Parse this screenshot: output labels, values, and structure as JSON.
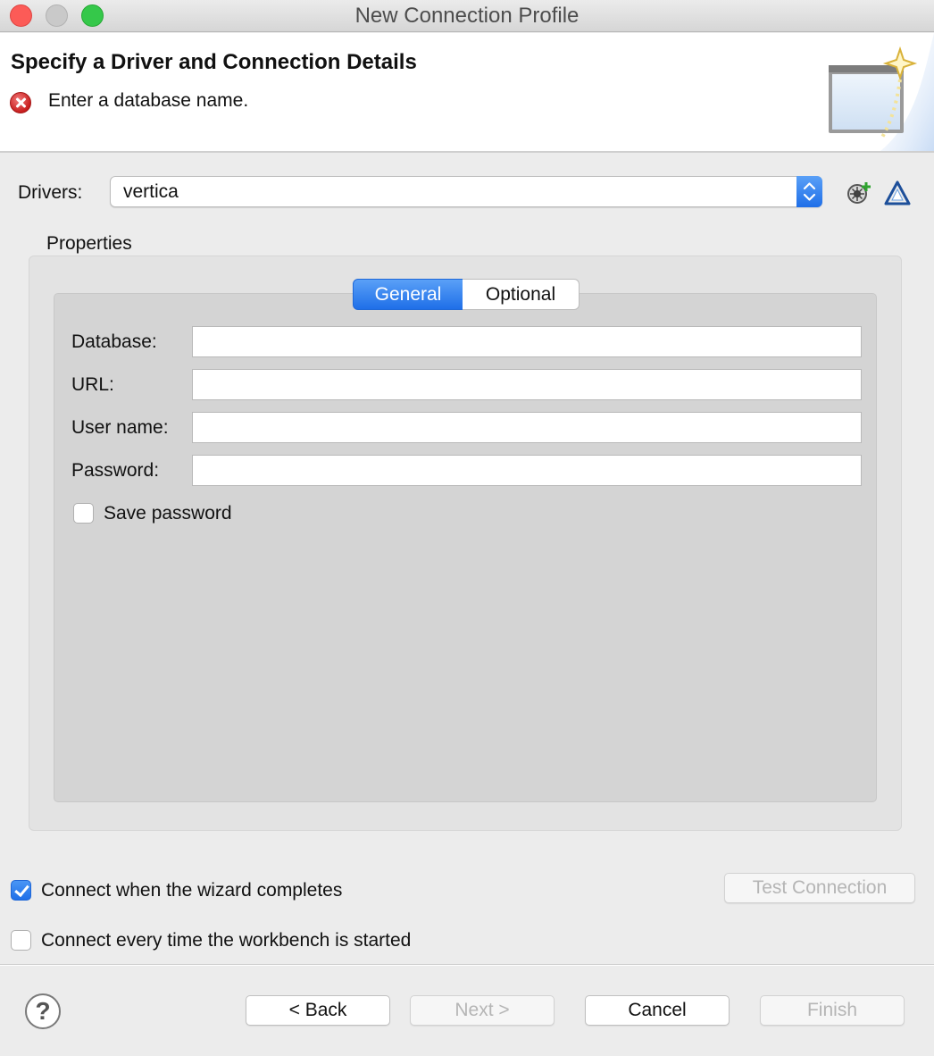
{
  "window": {
    "title": "New Connection Profile"
  },
  "header": {
    "title": "Specify a Driver and Connection Details",
    "message": "Enter a database name.",
    "message_icon": "error-icon"
  },
  "drivers": {
    "label": "Drivers:",
    "selected": "vertica",
    "new_driver_icon": "new-driver-icon",
    "edit_driver_icon": "edit-driver-icon"
  },
  "properties": {
    "label": "Properties",
    "tabs": [
      {
        "label": "General",
        "selected": true
      },
      {
        "label": "Optional",
        "selected": false
      }
    ],
    "fields": [
      {
        "label": "Database:",
        "value": ""
      },
      {
        "label": "URL:",
        "value": ""
      },
      {
        "label": "User name:",
        "value": ""
      },
      {
        "label": "Password:",
        "value": ""
      }
    ],
    "save_password": {
      "label": "Save password",
      "checked": false
    }
  },
  "options": {
    "connect_on_complete": {
      "label": "Connect when the wizard completes",
      "checked": true
    },
    "connect_on_start": {
      "label": "Connect every time the workbench is started",
      "checked": false
    },
    "test_connection": "Test Connection"
  },
  "footer": {
    "help_icon": "help-icon",
    "help_glyph": "?",
    "back": "< Back",
    "next": "Next >",
    "cancel": "Cancel",
    "finish": "Finish"
  },
  "colors": {
    "accent": "#1f6fe8",
    "error": "#c81e1e",
    "close": "#fc5b57",
    "maximize": "#35c84a"
  }
}
